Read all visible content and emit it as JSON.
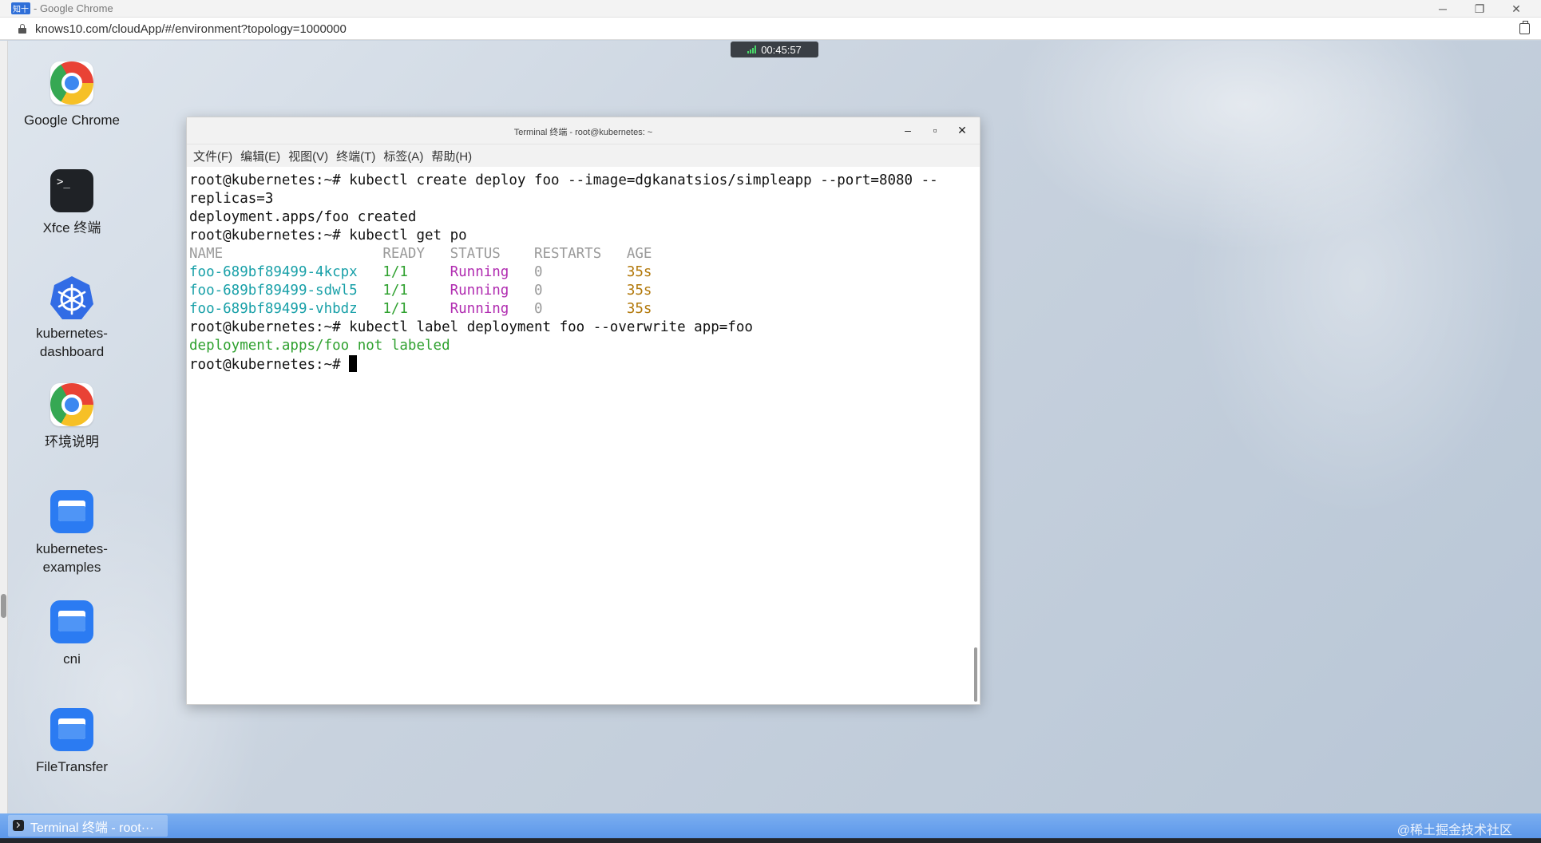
{
  "browser": {
    "title": "知十 - Google Chrome",
    "logo_text": "知十",
    "title_suffix": "- Google Chrome",
    "url": "knows10.com/cloudApp/#/environment?topology=1000000",
    "controls": {
      "minimize": "─",
      "restore": "❐",
      "close": "✕"
    }
  },
  "timer": {
    "value": "00:45:57"
  },
  "desktop_icons": [
    {
      "label": "Google Chrome",
      "icon": "chrome-icon"
    },
    {
      "label": "Xfce 终端",
      "icon": "terminal-icon"
    },
    {
      "label": "kubernetes-dashboard",
      "icon": "kubernetes-icon"
    },
    {
      "label": "环境说明",
      "icon": "chrome-icon"
    },
    {
      "label": "kubernetes-examples",
      "icon": "folder-icon"
    },
    {
      "label": "cni",
      "icon": "folder-icon"
    },
    {
      "label": "FileTransfer",
      "icon": "folder-icon"
    }
  ],
  "terminal": {
    "title": "Terminal 终端 - root@kubernetes: ~",
    "controls": {
      "minimize": "–",
      "maximize": "▫",
      "close": "✕"
    },
    "menu": [
      "文件(F)",
      "编辑(E)",
      "视图(V)",
      "终端(T)",
      "标签(A)",
      "帮助(H)"
    ],
    "lines": {
      "cmd1_prompt": "root@kubernetes:~# ",
      "cmd1": "kubectl create deploy foo --image=dgkanatsios/simpleapp --port=8080 --",
      "cmd1_wrap": "replicas=3",
      "out1": "deployment.apps/foo created",
      "cmd2_prompt": "root@kubernetes:~# ",
      "cmd2": "kubectl get po",
      "cmd3_prompt": "root@kubernetes:~# ",
      "cmd3": "kubectl label deployment foo --overwrite app=foo",
      "out3": "deployment.apps/foo not labeled",
      "cmd4_prompt": "root@kubernetes:~# "
    },
    "pod_table": {
      "headers": {
        "name": "NAME",
        "ready": "READY",
        "status": "STATUS",
        "restarts": "RESTARTS",
        "age": "AGE"
      },
      "rows": [
        {
          "name": "foo-689bf89499-4kcpx",
          "ready": "1/1",
          "status": "Running",
          "restarts": "0",
          "age": "35s"
        },
        {
          "name": "foo-689bf89499-sdwl5",
          "ready": "1/1",
          "status": "Running",
          "restarts": "0",
          "age": "35s"
        },
        {
          "name": "foo-689bf89499-vhbdz",
          "ready": "1/1",
          "status": "Running",
          "restarts": "0",
          "age": "35s"
        }
      ]
    }
  },
  "taskbar": {
    "active_task": "Terminal 终端 - root···",
    "watermark": "@稀土掘金技术社区"
  }
}
